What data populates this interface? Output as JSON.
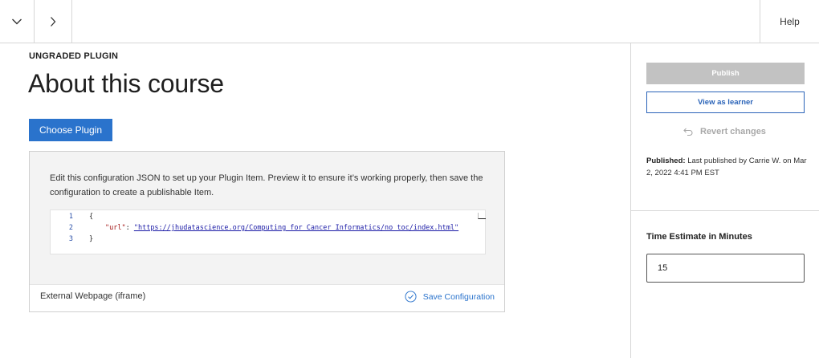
{
  "topbar": {
    "collapse_icon": "chevron-down-icon",
    "next_icon": "chevron-right-icon",
    "help_label": "Help"
  },
  "main": {
    "eyebrow": "UNGRADED PLUGIN",
    "title": "About this course",
    "choose_plugin_label": "Choose Plugin",
    "config": {
      "description": "Edit this configuration JSON to set up your Plugin Item. Preview it to ensure it’s working properly, then save the configuration to create a publishable Item.",
      "editor": {
        "line_numbers": [
          "1",
          "2",
          "3"
        ],
        "line1": "{",
        "line2_key": "\"url\"",
        "line2_sep": ": ",
        "line2_value": "\"https://jhudatascience.org/Computing_for_Cancer_Informatics/no_toc/index.html\"",
        "line3": "}"
      },
      "plugin_type": "External Webpage (iframe)",
      "save_label": "Save Configuration"
    }
  },
  "sidebar": {
    "publish_label": "Publish",
    "view_as_learner_label": "View as learner",
    "revert_label": "Revert changes",
    "published_label": "Published:",
    "published_text": "Last published by Carrie W. on Mar 2, 2022 4:41 PM EST",
    "time_estimate_label": "Time Estimate in Minutes",
    "time_estimate_value": "15"
  },
  "colors": {
    "accent": "#2a73cc",
    "disabled": "#c2c2c2",
    "border": "#d6d6d6"
  }
}
